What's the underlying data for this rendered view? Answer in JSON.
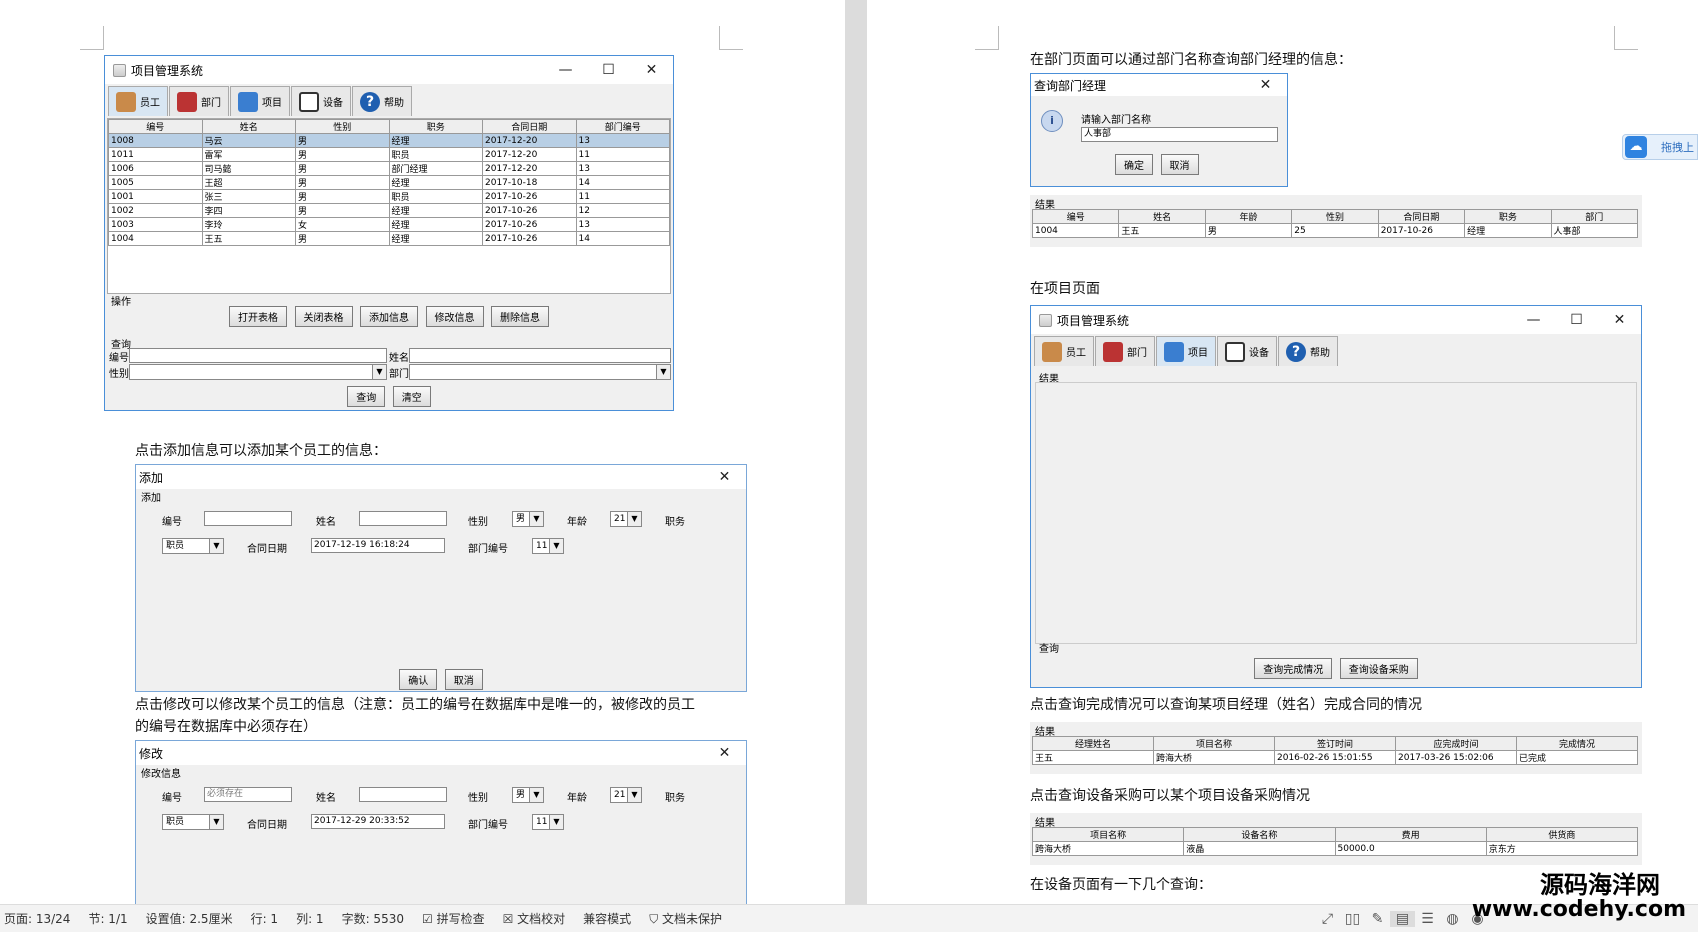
{
  "statusbar": {
    "page": "页面: 13/24",
    "section": "节: 1/1",
    "setting": "设置值: 2.5厘米",
    "row": "行: 1",
    "col": "列: 1",
    "words": "字数: 5530",
    "spell": "拼写检查",
    "proof": "文档校对",
    "compat": "兼容模式",
    "protect": "文档未保护"
  },
  "watermark": {
    "line1": "源码海洋网",
    "line2": "www.codehy.com"
  },
  "side_button": {
    "label": "拖拽上"
  },
  "left": {
    "main_window": {
      "title": "项目管理系统",
      "tabs": [
        "员工",
        "部门",
        "项目",
        "设备",
        "帮助"
      ],
      "columns": [
        "编号",
        "姓名",
        "性别",
        "职务",
        "合同日期",
        "部门编号"
      ],
      "rows": [
        [
          "1008",
          "马云",
          "男",
          "经理",
          "2017-12-20",
          "13"
        ],
        [
          "1011",
          "雷军",
          "男",
          "职员",
          "2017-12-20",
          "11"
        ],
        [
          "1006",
          "司马懿",
          "男",
          "部门经理",
          "2017-12-20",
          "13"
        ],
        [
          "1005",
          "王超",
          "男",
          "经理",
          "2017-10-18",
          "14"
        ],
        [
          "1001",
          "张三",
          "男",
          "职员",
          "2017-10-26",
          "11"
        ],
        [
          "1002",
          "李四",
          "男",
          "经理",
          "2017-10-26",
          "12"
        ],
        [
          "1003",
          "李玲",
          "女",
          "经理",
          "2017-10-26",
          "13"
        ],
        [
          "1004",
          "王五",
          "男",
          "经理",
          "2017-10-26",
          "14"
        ]
      ],
      "op_label": "操作",
      "op_buttons": [
        "打开表格",
        "关闭表格",
        "添加信息",
        "修改信息",
        "删除信息"
      ],
      "query_label": "查询",
      "f_id": "编号",
      "f_name": "姓名",
      "f_gender": "性别",
      "f_dept": "部门",
      "q_buttons": [
        "查询",
        "清空"
      ]
    },
    "para_add": "点击添加信息可以添加某个员工的信息：",
    "add_dialog": {
      "title": "添加",
      "group": "添加",
      "l_id": "编号",
      "l_name": "姓名",
      "l_gender": "性别",
      "gender": "男",
      "l_age": "年龄",
      "age": "21",
      "l_job": "职务",
      "job": "职员",
      "l_date": "合同日期",
      "date": "2017-12-19 16:18:24",
      "l_dept": "部门编号",
      "dept": "11",
      "ok": "确认",
      "cancel": "取消"
    },
    "para_edit1": "点击修改可以修改某个员工的信息（注意：员工的编号在数据库中是唯一的，被修改的员工",
    "para_edit2": "的编号在数据库中必须存在）",
    "edit_dialog": {
      "title": "修改",
      "group": "修改信息",
      "l_id": "编号",
      "id_placeholder": "必须存在",
      "l_name": "姓名",
      "l_gender": "性别",
      "gender": "男",
      "l_age": "年龄",
      "age": "21",
      "l_job": "职务",
      "job": "职员",
      "l_date": "合同日期",
      "date": "2017-12-29 20:33:52",
      "l_dept": "部门编号",
      "dept": "11"
    }
  },
  "right": {
    "para_dept": "在部门页面可以通过部门名称查询部门经理的信息：",
    "dept_dialog": {
      "title": "查询部门经理",
      "prompt": "请输入部门名称",
      "value": "人事部",
      "ok": "确定",
      "cancel": "取消"
    },
    "dept_result": {
      "label": "结果",
      "columns": [
        "编号",
        "姓名",
        "年龄",
        "性别",
        "合同日期",
        "职务",
        "部门"
      ],
      "row": [
        "1004",
        "王五",
        "男",
        "25",
        "2017-10-26",
        "经理",
        "人事部"
      ]
    },
    "para_proj": "在项目页面",
    "proj_window": {
      "title": "项目管理系统",
      "tabs": [
        "员工",
        "部门",
        "项目",
        "设备",
        "帮助"
      ],
      "result_label": "结果",
      "query_label": "查询",
      "buttons": [
        "查询完成情况",
        "查询设备采购"
      ]
    },
    "para_done": "点击查询完成情况可以查询某项目经理（姓名）完成合同的情况",
    "done_result": {
      "label": "结果",
      "columns": [
        "经理姓名",
        "项目名称",
        "签订时间",
        "应完成时间",
        "完成情况"
      ],
      "row": [
        "王五",
        "跨海大桥",
        "2016-02-26 15:01:55",
        "2017-03-26 15:02:06",
        "已完成"
      ]
    },
    "para_equip": "点击查询设备采购可以某个项目设备采购情况",
    "equip_result": {
      "label": "结果",
      "columns": [
        "项目名称",
        "设备名称",
        "费用",
        "供货商"
      ],
      "row": [
        "跨海大桥",
        "液晶",
        "50000.0",
        "京东方"
      ]
    },
    "para_equip2": "在设备页面有一下几个查询："
  }
}
